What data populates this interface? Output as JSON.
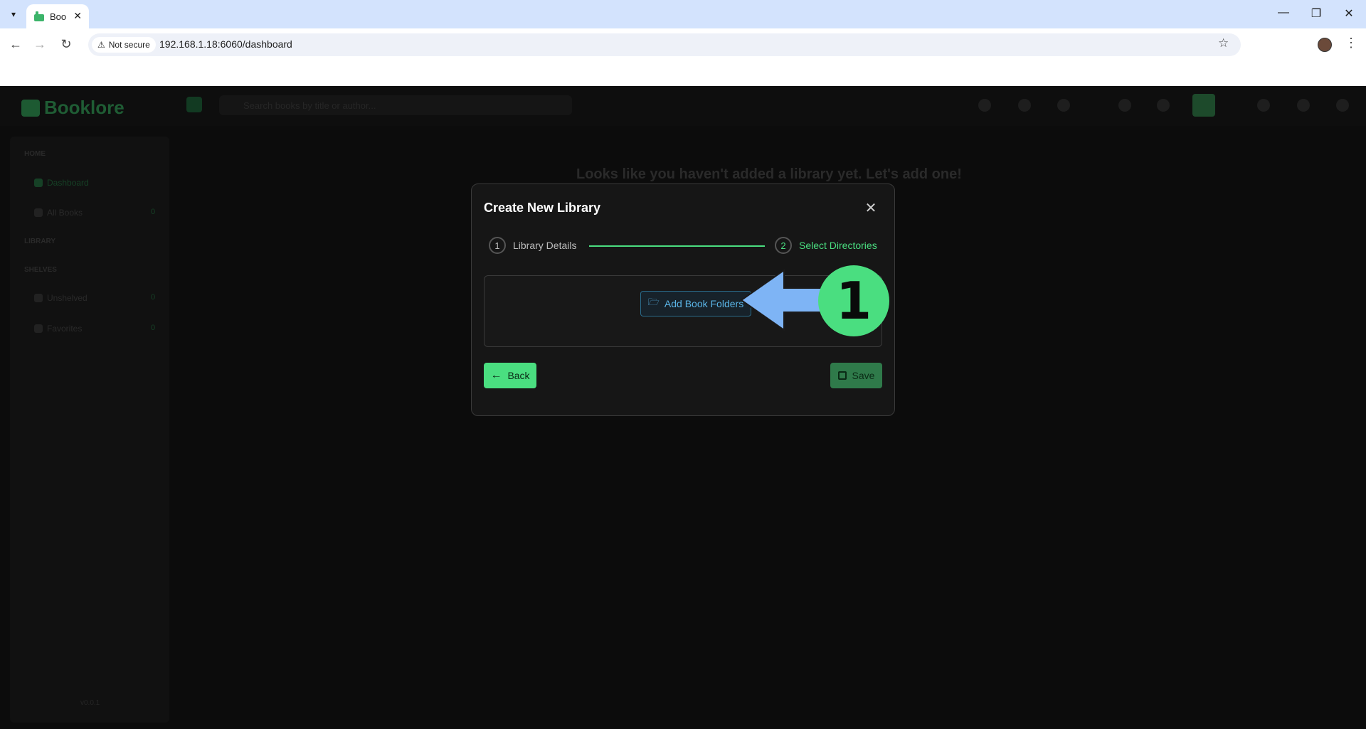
{
  "browser": {
    "tab_title": "Boo",
    "security_label": "Not secure",
    "url": "192.168.1.18:6060/dashboard"
  },
  "app": {
    "logo_text": "Booklore",
    "search_placeholder": "Search books by title or author...",
    "empty_message": "Looks like you haven't added a library yet. Let's add one!",
    "sidebar": {
      "home_section": "HOME",
      "library_section": "LIBRARY",
      "shelves_section": "SHELVES",
      "items": [
        {
          "label": "Dashboard",
          "count": ""
        },
        {
          "label": "All Books",
          "count": "0"
        },
        {
          "label": "Unshelved",
          "count": "0"
        },
        {
          "label": "Favorites",
          "count": "0"
        }
      ],
      "version": "v0.0.1"
    }
  },
  "modal": {
    "title": "Create New Library",
    "close_symbol": "✕",
    "steps": [
      {
        "number": "1",
        "label": "Library Details"
      },
      {
        "number": "2",
        "label": "Select Directories"
      }
    ],
    "add_folders_label": "Add Book Folders",
    "back_label": "Back",
    "save_label": "Save"
  },
  "annotation": {
    "number": "1",
    "arrow_color": "#7eb4f5",
    "circle_color": "#4ade80"
  },
  "colors": {
    "accent": "#4ade80",
    "link": "#5ab4e6"
  }
}
